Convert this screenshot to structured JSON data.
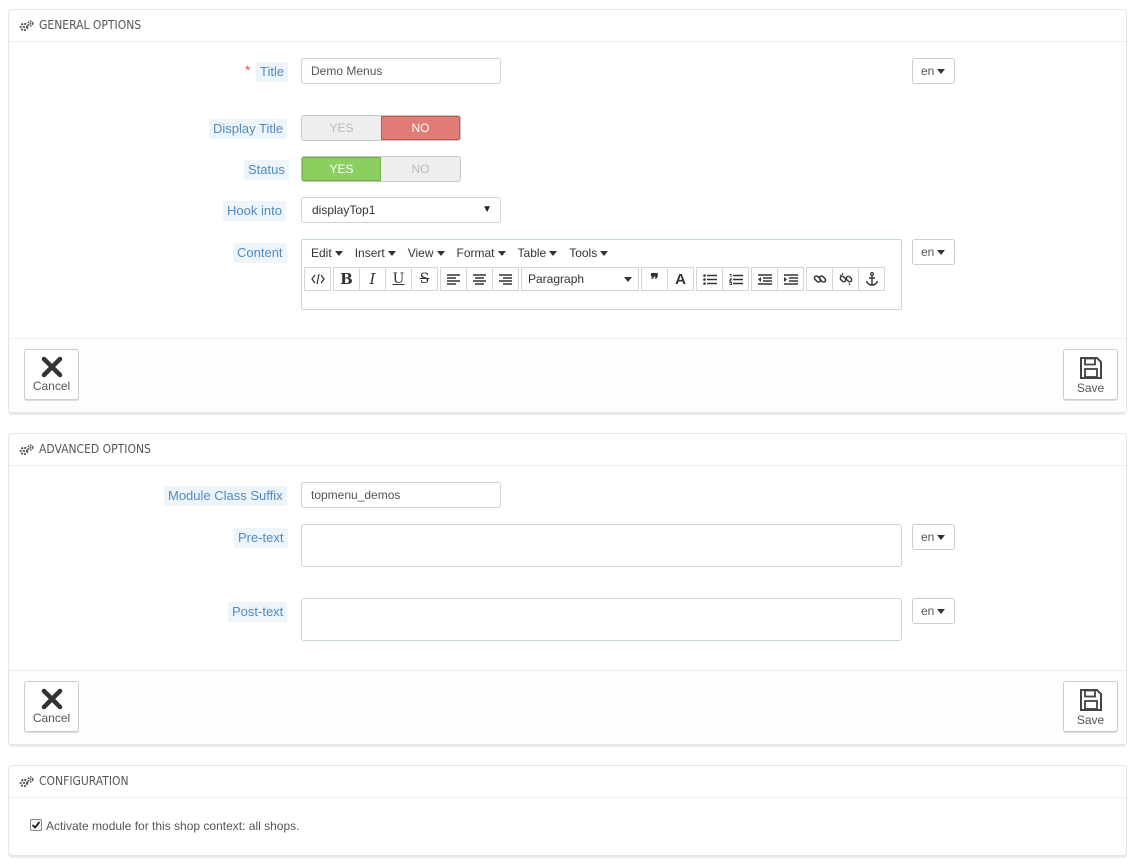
{
  "general": {
    "heading": "GENERAL OPTIONS",
    "title_label": "Title",
    "title_required_mark": "*",
    "title_value": "Demo Menus",
    "lang": "en",
    "display_title_label": "Display Title",
    "display_title_yes": "YES",
    "display_title_no": "NO",
    "display_title_value": "NO",
    "status_label": "Status",
    "status_yes": "YES",
    "status_no": "NO",
    "status_value": "YES",
    "hook_label": "Hook into",
    "hook_value": "displayTop1",
    "content_label": "Content",
    "editor_menu": [
      "Edit",
      "Insert",
      "View",
      "Format",
      "Table",
      "Tools"
    ],
    "editor_format_select": "Paragraph",
    "cancel_label": "Cancel",
    "save_label": "Save"
  },
  "advanced": {
    "heading": "ADVANCED OPTIONS",
    "suffix_label": "Module Class Suffix",
    "suffix_value": "topmenu_demos",
    "pretext_label": "Pre-text",
    "posttext_label": "Post-text",
    "lang": "en",
    "cancel_label": "Cancel",
    "save_label": "Save"
  },
  "configuration": {
    "heading": "CONFIGURATION",
    "activate_text": "Activate module for this shop context: all shops.",
    "activate_checked": true
  },
  "colors": {
    "label_bg": "#eef5fa",
    "label_text": "#4f8bbf",
    "switch_no_active": "#e07b75",
    "switch_yes_active": "#8ccf60",
    "required": "#e05555"
  }
}
